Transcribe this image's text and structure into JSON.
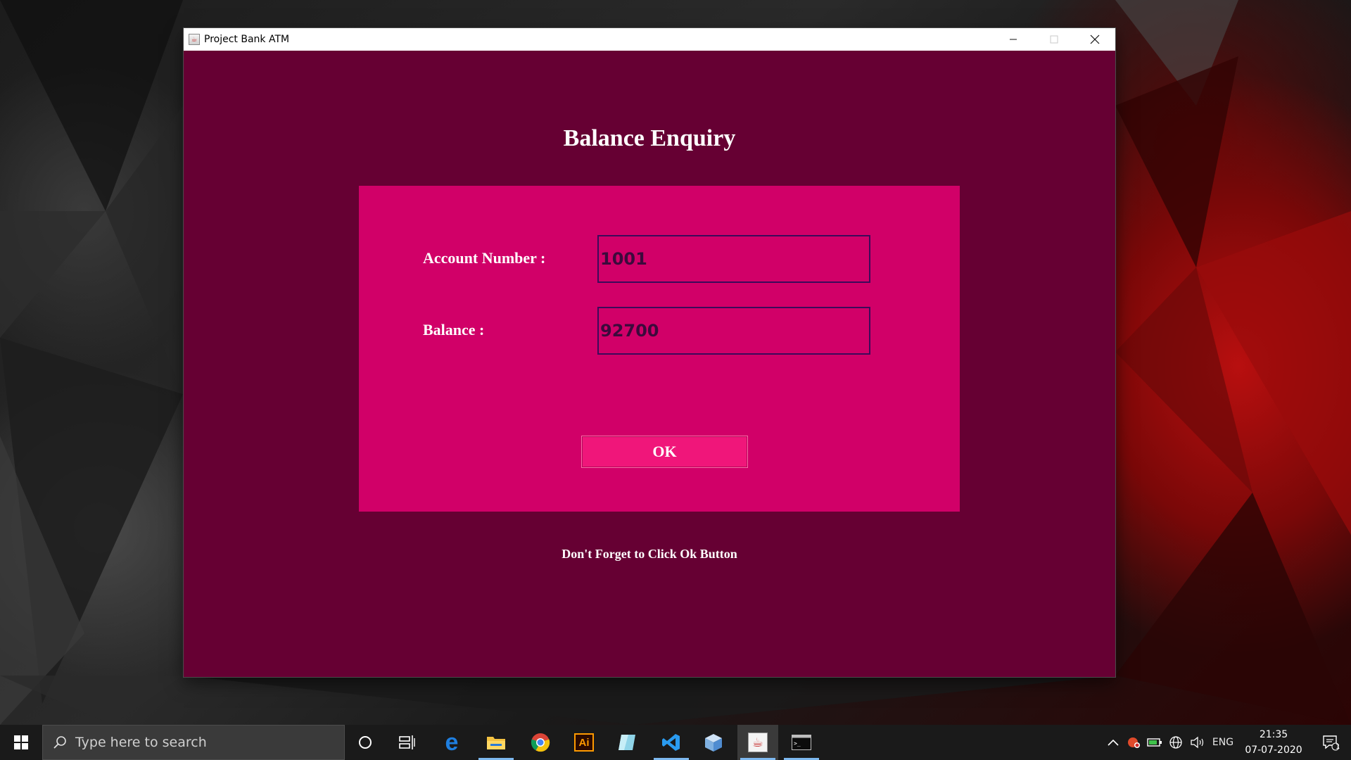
{
  "window": {
    "title": "Project Bank ATM",
    "app_icon": "java-icon",
    "minimize_icon": "minimize-icon",
    "maximize_icon": "maximize-icon",
    "close_icon": "close-icon"
  },
  "page": {
    "heading": "Balance Enquiry",
    "account_label": "Account Number :",
    "account_value": "1001",
    "balance_label": "Balance :",
    "balance_value": "92700",
    "ok_label": "OK",
    "footer_note": "Don't Forget to Click Ok Button"
  },
  "colors": {
    "window_bg": "#660033",
    "panel_bg": "#d10068",
    "button_bg": "#f0167a",
    "field_border": "#3c0a5a"
  },
  "taskbar": {
    "search_placeholder": "Type here to search",
    "pinned": [
      {
        "name": "cortana-icon"
      },
      {
        "name": "task-view-icon"
      },
      {
        "name": "edge-icon"
      },
      {
        "name": "file-explorer-icon"
      },
      {
        "name": "chrome-icon"
      },
      {
        "name": "illustrator-icon",
        "text": "Ai"
      },
      {
        "name": "app-icon"
      },
      {
        "name": "vscode-icon"
      },
      {
        "name": "virtualbox-icon"
      },
      {
        "name": "java-icon"
      },
      {
        "name": "terminal-icon"
      }
    ],
    "tray": {
      "language": "ENG",
      "time": "21:35",
      "date": "07-07-2020",
      "notification_count": "1"
    }
  }
}
